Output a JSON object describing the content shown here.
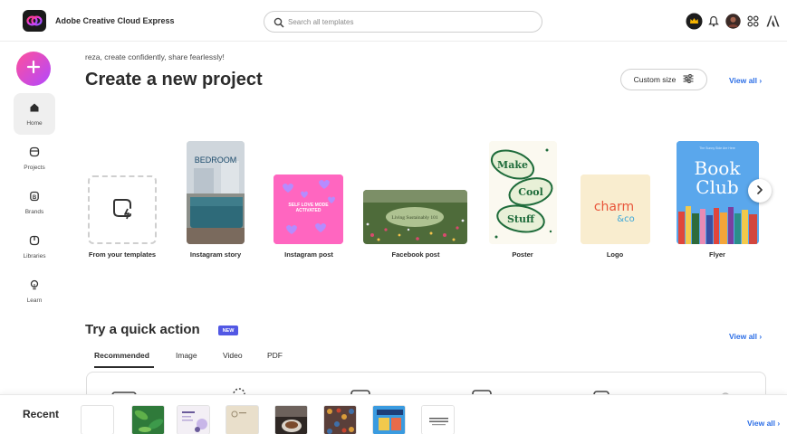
{
  "header": {
    "app_title": "Adobe Creative Cloud Express",
    "search_placeholder": "Search all templates",
    "icons": [
      "creative-cloud-logo-icon",
      "search-icon",
      "crown-icon",
      "bell-icon",
      "avatar",
      "apps-grid-icon",
      "adobe-logo-icon"
    ]
  },
  "sidebar": {
    "create_icon": "plus-icon",
    "items": [
      {
        "label": "Home",
        "icon": "home-icon"
      },
      {
        "label": "Projects",
        "icon": "projects-icon"
      },
      {
        "label": "Brands",
        "icon": "brands-icon"
      },
      {
        "label": "Libraries",
        "icon": "libraries-icon"
      },
      {
        "label": "Learn",
        "icon": "lightbulb-icon"
      }
    ]
  },
  "main": {
    "greeting": "reza, create confidently, share fearlessly!",
    "title": "Create a new project",
    "custom_size_label": "Custom size",
    "view_all": "View all ›",
    "projects": [
      {
        "label": "From your templates"
      },
      {
        "label": "Instagram story",
        "thumb_text": "BEDROOM"
      },
      {
        "label": "Instagram post",
        "thumb_text": "SELF LOVE MODE ACTIVATED"
      },
      {
        "label": "Facebook post",
        "thumb_text": "Living Sustainably 101"
      },
      {
        "label": "Poster",
        "thumb_text": [
          "Make",
          "Cool",
          "Stuff"
        ]
      },
      {
        "label": "Logo",
        "thumb_text": [
          "charm",
          "&co"
        ]
      },
      {
        "label": "Flyer",
        "thumb_text": [
          "Book",
          "Club"
        ],
        "thumb_subtext": "The Sunny Side Are Here"
      }
    ]
  },
  "quick_actions": {
    "title": "Try a quick action",
    "badge": "NEW",
    "view_all": "View all ›",
    "tabs": [
      "Recommended",
      "Image",
      "Video",
      "PDF"
    ],
    "active_tab": "Recommended"
  },
  "recent": {
    "label": "Recent",
    "view_all": "View all ›",
    "thumbs": [
      "blank",
      "green-leaves",
      "beige-doc",
      "beige-card",
      "coffee-photo",
      "mosaic-photo",
      "blue-poster",
      "text-doc"
    ]
  },
  "colors": {
    "accent": "#2c6ee6",
    "fab_start": "#ff4f9b",
    "fab_end": "#b249ff",
    "new_badge": "#5258e4"
  }
}
